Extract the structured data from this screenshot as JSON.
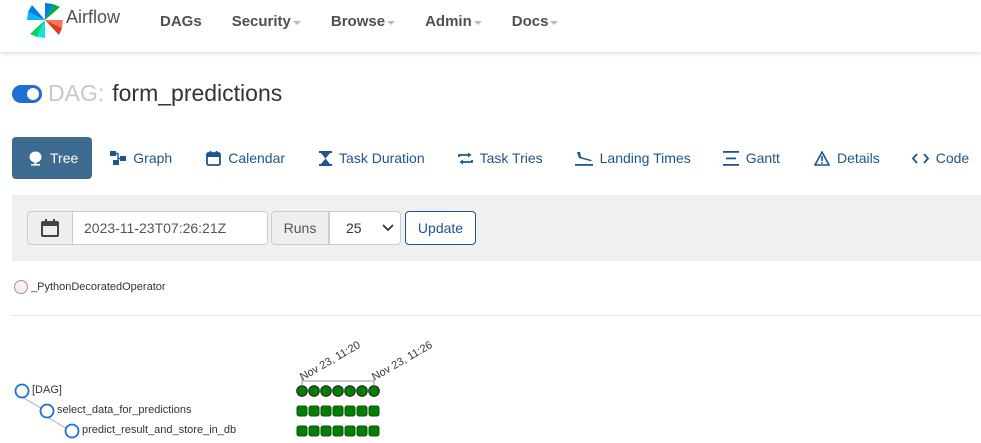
{
  "brand": {
    "name": "Airflow"
  },
  "nav": [
    {
      "label": "DAGs",
      "dropdown": false
    },
    {
      "label": "Security",
      "dropdown": true
    },
    {
      "label": "Browse",
      "dropdown": true
    },
    {
      "label": "Admin",
      "dropdown": true
    },
    {
      "label": "Docs",
      "dropdown": true
    }
  ],
  "dag": {
    "prefix": "DAG:",
    "name": "form_predictions",
    "paused": false
  },
  "tabs": [
    {
      "label": "Tree",
      "icon": "tree-icon",
      "active": true
    },
    {
      "label": "Graph",
      "icon": "graph-icon"
    },
    {
      "label": "Calendar",
      "icon": "calendar-icon"
    },
    {
      "label": "Task Duration",
      "icon": "hourglass-icon"
    },
    {
      "label": "Task Tries",
      "icon": "retry-icon"
    },
    {
      "label": "Landing Times",
      "icon": "landing-icon"
    },
    {
      "label": "Gantt",
      "icon": "gantt-icon"
    },
    {
      "label": "Details",
      "icon": "warning-icon"
    },
    {
      "label": "Code",
      "icon": "code-icon"
    }
  ],
  "filter": {
    "base_date": "2023-11-23T07:26:21Z",
    "runs_label": "Runs",
    "runs_value": "25",
    "update_label": "Update"
  },
  "legend": {
    "operator": "_PythonDecoratedOperator"
  },
  "tree": {
    "dates": [
      "Nov 23, 11:20",
      "Nov 23, 11:26"
    ],
    "nodes": [
      "[DAG]",
      "select_data_for_predictions",
      "predict_result_and_store_in_db"
    ],
    "run_count": 7,
    "success_color": "#008000"
  },
  "colors": {
    "accent": "#1e6fd1",
    "active_tab": "#3d6a8f",
    "link": "#1e5590"
  }
}
